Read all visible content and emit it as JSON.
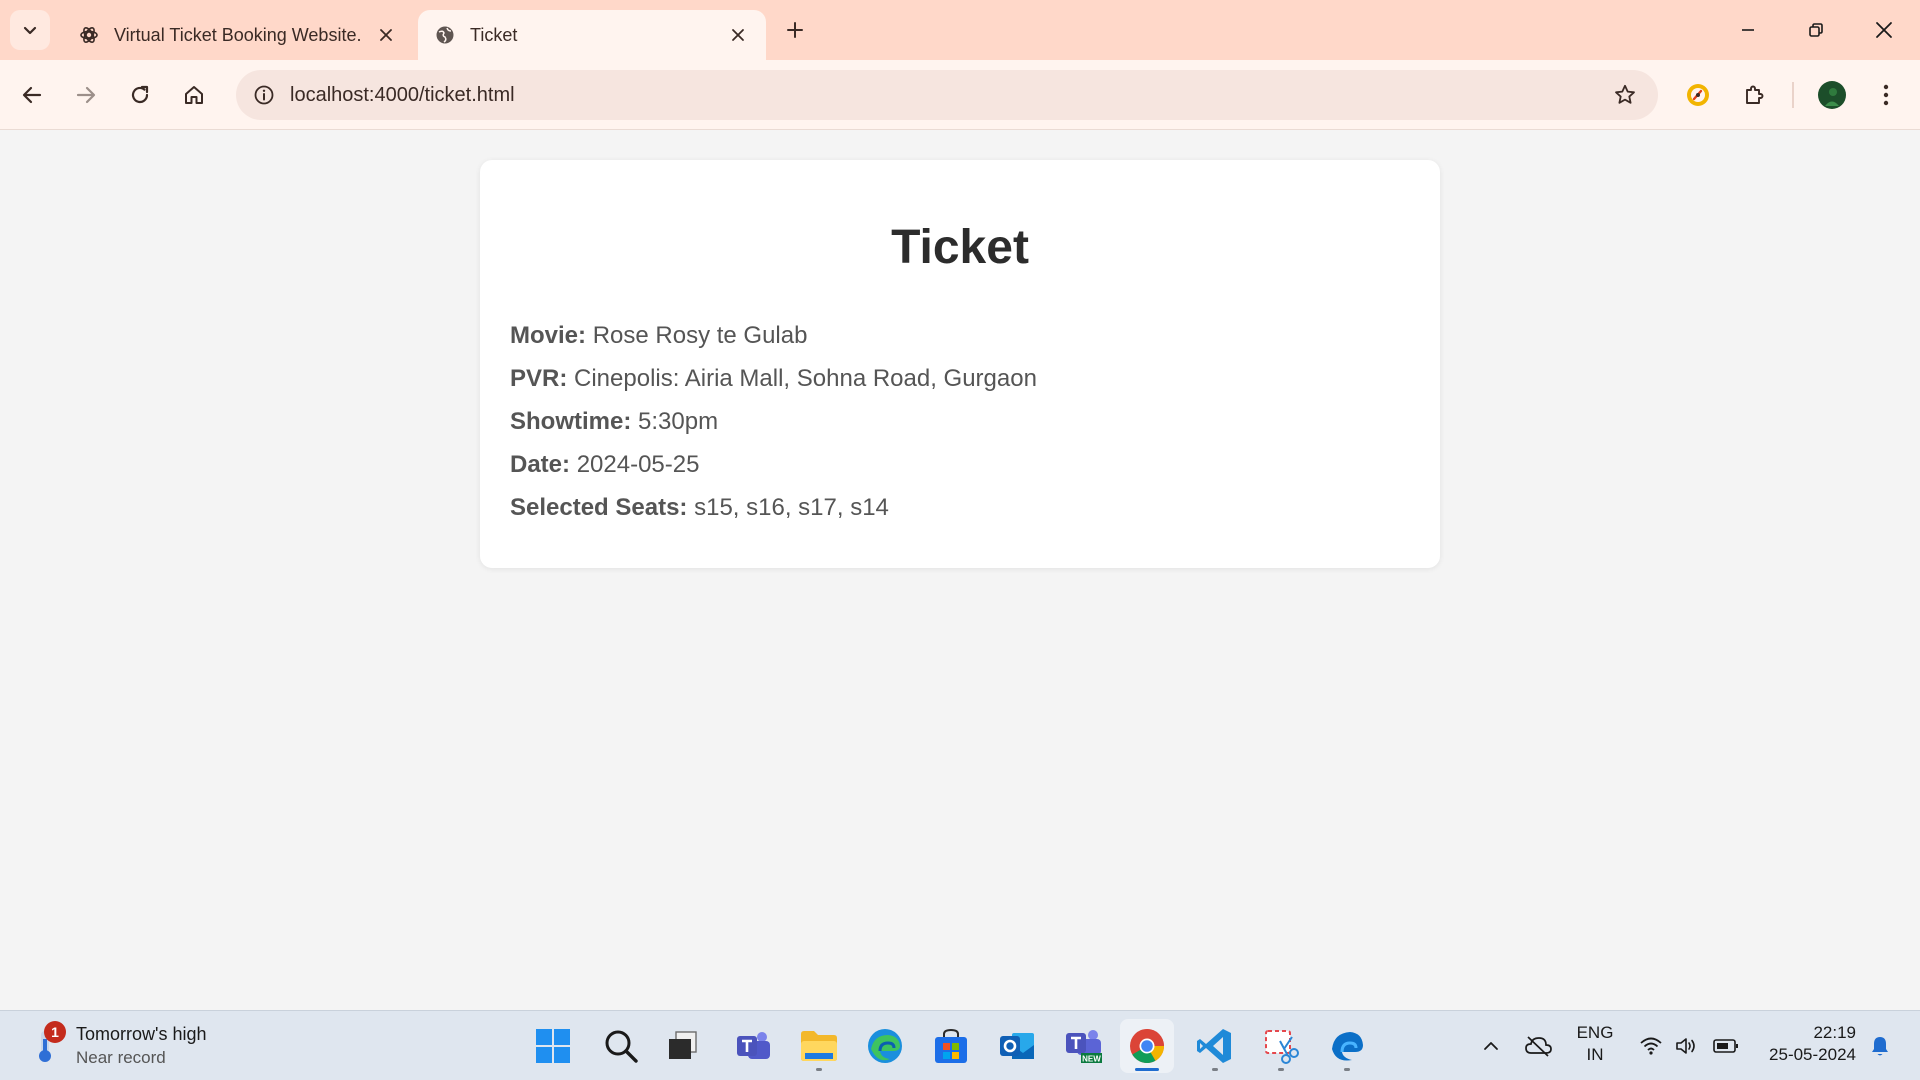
{
  "browser": {
    "tabs": [
      {
        "title": "Virtual Ticket Booking Website.",
        "icon": "openai-icon",
        "active": false
      },
      {
        "title": "Ticket",
        "icon": "globe-icon",
        "active": true
      }
    ],
    "url": "localhost:4000/ticket.html"
  },
  "ticket": {
    "heading": "Ticket",
    "details": [
      {
        "label": "Movie:",
        "value": "Rose Rosy te Gulab"
      },
      {
        "label": "PVR:",
        "value": "Cinepolis: Airia Mall, Sohna Road, Gurgaon"
      },
      {
        "label": "Showtime:",
        "value": "5:30pm"
      },
      {
        "label": "Date:",
        "value": "2024-05-25"
      },
      {
        "label": "Selected Seats:",
        "value": "s15, s16, s17, s14"
      }
    ]
  },
  "taskbar": {
    "weather": {
      "badge": "1",
      "line1": "Tomorrow's high",
      "line2": "Near record"
    },
    "apps": [
      "windows-start",
      "search",
      "task-view",
      "teams",
      "file-explorer",
      "edge",
      "microsoft-store",
      "outlook",
      "teams-new",
      "chrome",
      "vscode",
      "snipping-tool",
      "edge-beta"
    ],
    "language": {
      "line1": "ENG",
      "line2": "IN"
    },
    "clock": {
      "time": "22:19",
      "date": "25-05-2024"
    }
  },
  "colors": {
    "tab_strip": "#ffd8c9",
    "toolbar": "#fff4ef",
    "page_background": "#f4f4f4",
    "card": "#ffffff",
    "taskbar": "#dfe6ef"
  }
}
